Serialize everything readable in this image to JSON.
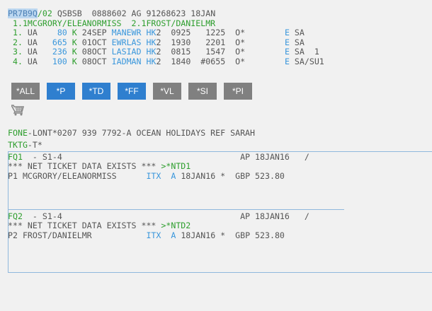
{
  "colors": {
    "green": "#2e9e2e",
    "blue": "#3a97dc",
    "gray": "#555555",
    "button_gray": "#808080",
    "button_blue": "#2f7fcf"
  },
  "pnr": {
    "lines": [
      [
        {
          "t": "PR7B9Q",
          "c": "hl"
        },
        {
          "t": "/02",
          "c": "g"
        },
        {
          "t": " QSBSB  0888602 AG 91268623 18JAN",
          "c": "n"
        }
      ],
      [
        {
          "t": " 1.1MCGRORY/ELEANORMISS  2.1FROST/DANIELMR",
          "c": "g"
        }
      ],
      [
        {
          "t": " 1.",
          "c": "g"
        },
        {
          "t": " UA  ",
          "c": "n"
        },
        {
          "t": "  80",
          "c": "b"
        },
        {
          "t": " K",
          "c": "g"
        },
        {
          "t": " 24SEP ",
          "c": "n"
        },
        {
          "t": "MANEWR HK",
          "c": "b"
        },
        {
          "t": "2  0925   1225  O*        ",
          "c": "n"
        },
        {
          "t": "E",
          "c": "b"
        },
        {
          "t": " SA",
          "c": "n"
        }
      ],
      [
        {
          "t": " 2.",
          "c": "g"
        },
        {
          "t": " UA  ",
          "c": "n"
        },
        {
          "t": " 665",
          "c": "b"
        },
        {
          "t": " K",
          "c": "g"
        },
        {
          "t": " 01OCT ",
          "c": "n"
        },
        {
          "t": "EWRLAS HK",
          "c": "b"
        },
        {
          "t": "2  1930   2201  O*        ",
          "c": "n"
        },
        {
          "t": "E",
          "c": "b"
        },
        {
          "t": " SA",
          "c": "n"
        }
      ],
      [
        {
          "t": " 3.",
          "c": "g"
        },
        {
          "t": " UA  ",
          "c": "n"
        },
        {
          "t": " 236",
          "c": "b"
        },
        {
          "t": " K",
          "c": "g"
        },
        {
          "t": " 08OCT ",
          "c": "n"
        },
        {
          "t": "LASIAD HK",
          "c": "b"
        },
        {
          "t": "2  0815   1547  O*        ",
          "c": "n"
        },
        {
          "t": "E",
          "c": "b"
        },
        {
          "t": " SA  1",
          "c": "n"
        }
      ],
      [
        {
          "t": " 4.",
          "c": "g"
        },
        {
          "t": " UA  ",
          "c": "n"
        },
        {
          "t": " 100",
          "c": "b"
        },
        {
          "t": " K",
          "c": "g"
        },
        {
          "t": " 08OCT ",
          "c": "n"
        },
        {
          "t": "IADMAN HK",
          "c": "b"
        },
        {
          "t": "2  1840  #0655  O*        ",
          "c": "n"
        },
        {
          "t": "E",
          "c": "b"
        },
        {
          "t": " SA/SU1",
          "c": "n"
        }
      ]
    ]
  },
  "buttons": [
    {
      "label": "*ALL",
      "style": "gray"
    },
    {
      "label": "*P",
      "style": "blue"
    },
    {
      "label": "*TD",
      "style": "blue"
    },
    {
      "label": "*FF",
      "style": "blue"
    },
    {
      "label": "*VL",
      "style": "gray"
    },
    {
      "label": "*SI",
      "style": "gray"
    },
    {
      "label": "*PI",
      "style": "gray"
    }
  ],
  "cart_icon": "shopping-cart-icon",
  "remarks": [
    [
      {
        "t": "FONE",
        "c": "g"
      },
      {
        "t": "-LONT*0207 939 7792-A OCEAN HOLIDAYS REF SARAH",
        "c": "n"
      }
    ],
    [
      {
        "t": "TKTG",
        "c": "g"
      },
      {
        "t": "-T*",
        "c": "n"
      }
    ]
  ],
  "fares": [
    [
      [
        {
          "t": "FQ1",
          "c": "g"
        },
        {
          "t": "  - S1-4                                    AP 18JAN16   /",
          "c": "n"
        }
      ],
      [
        {
          "t": "*** NET TICKET DATA EXISTS *** ",
          "c": "n"
        },
        {
          "t": ">*NTD1",
          "c": "g"
        }
      ],
      [
        {
          "t": "P1 MCGRORY/ELEANORMISS      ",
          "c": "n"
        },
        {
          "t": "ITX  A",
          "c": "b"
        },
        {
          "t": " 18JAN16 *  GBP 523.80",
          "c": "n"
        }
      ]
    ],
    [
      [
        {
          "t": "FQ2",
          "c": "g"
        },
        {
          "t": "  - S1-4                                    AP 18JAN16   /",
          "c": "n"
        }
      ],
      [
        {
          "t": "*** NET TICKET DATA EXISTS *** ",
          "c": "n"
        },
        {
          "t": ">*NTD2",
          "c": "g"
        }
      ],
      [
        {
          "t": "P2 FROST/DANIELMR           ",
          "c": "n"
        },
        {
          "t": "ITX  A",
          "c": "b"
        },
        {
          "t": " 18JAN16 *  GBP 523.80",
          "c": "n"
        }
      ]
    ]
  ]
}
